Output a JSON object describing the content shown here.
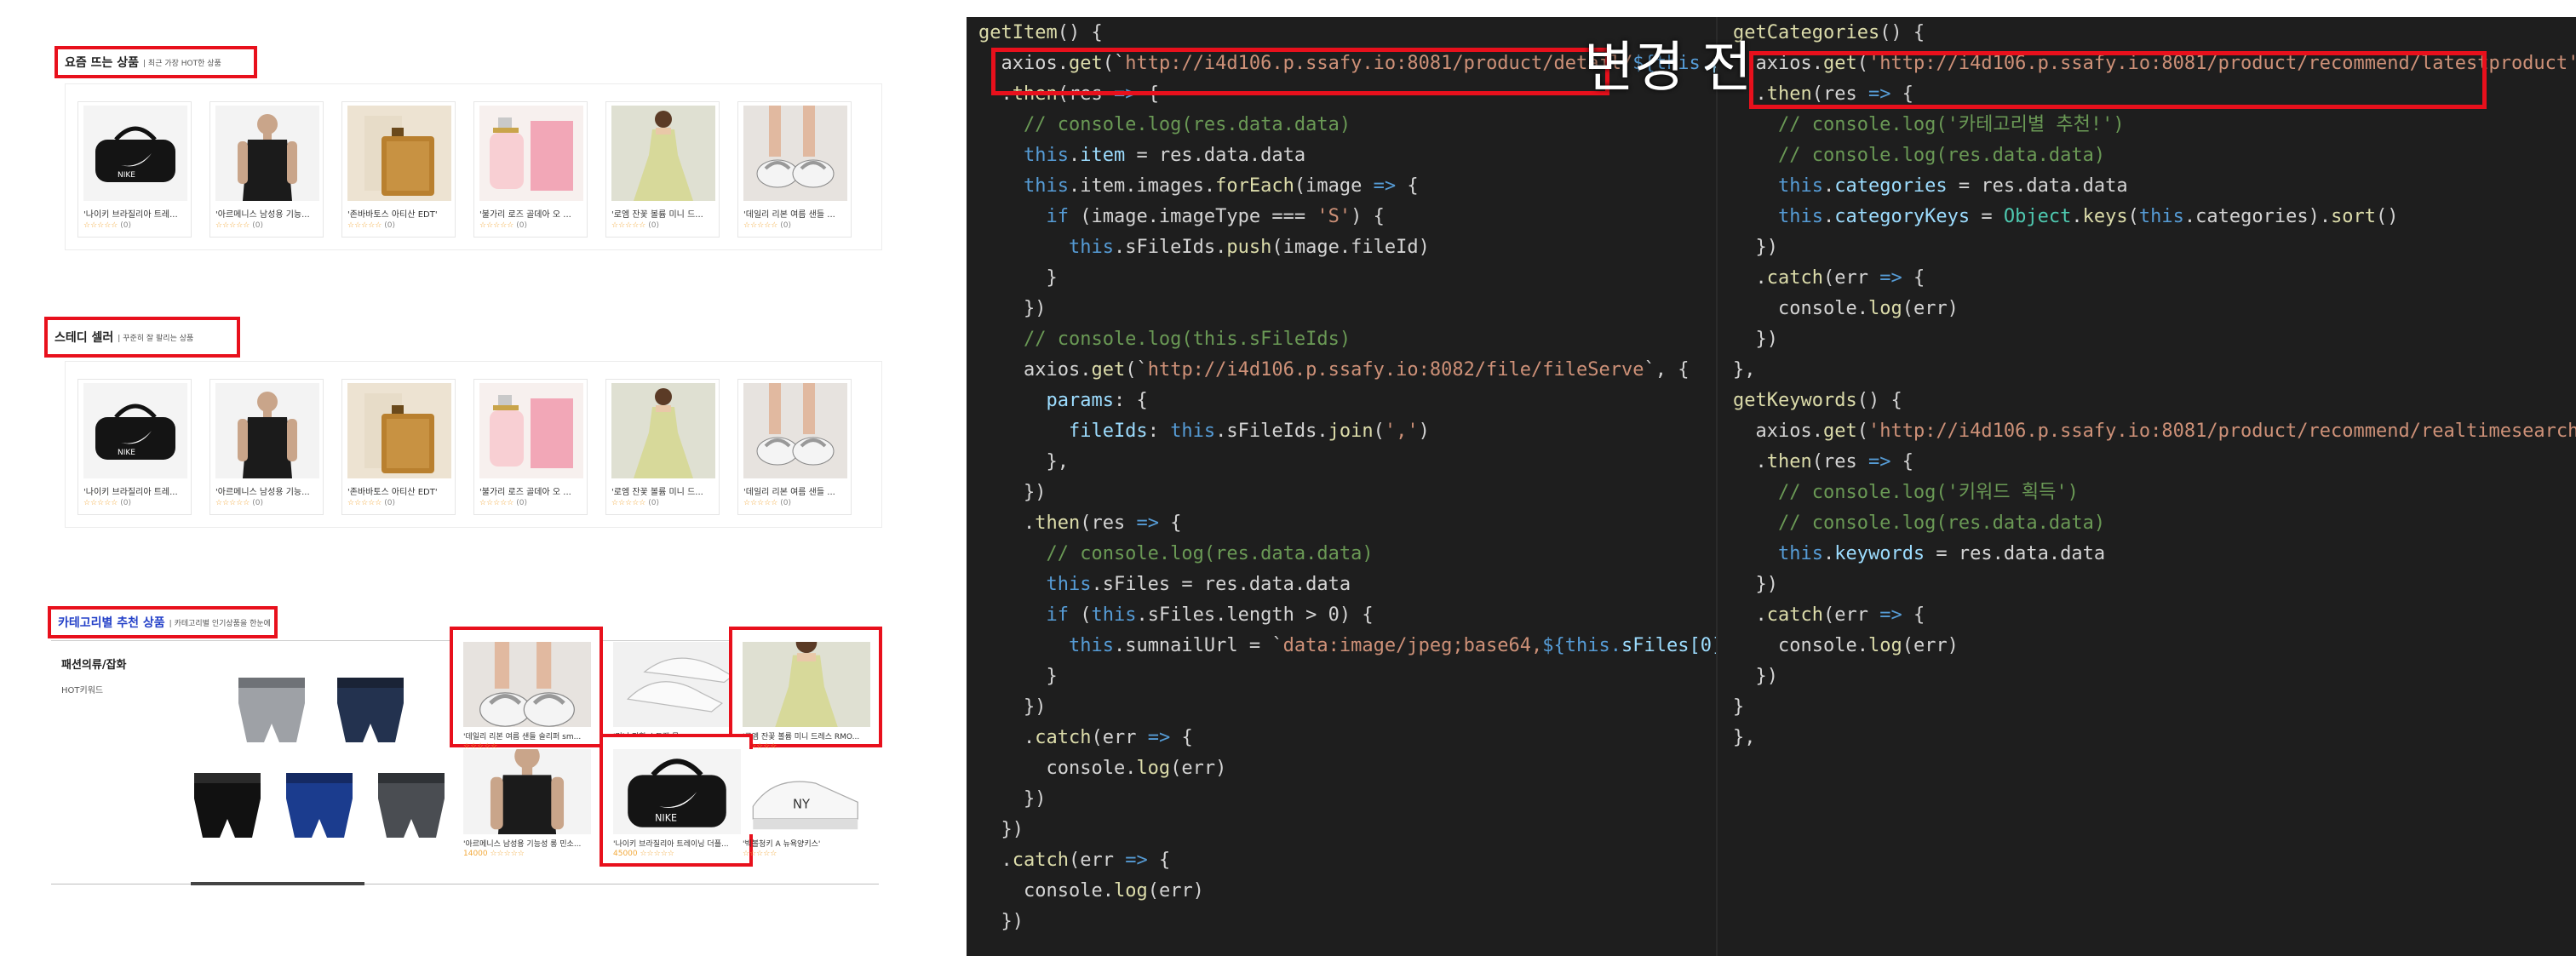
{
  "overlay_label": "변경 전",
  "shop": {
    "sections": [
      {
        "title": "요즘 뜨는 상품",
        "subtitle": "| 최근 가장 HOT한 상품"
      },
      {
        "title": "스테디 셀러",
        "subtitle": "| 꾸준히 잘 팔리는 상품"
      },
      {
        "title": "카테고리별 추천 상품",
        "subtitle": "| 카테고리별 인기상품을 한눈에"
      }
    ],
    "products": [
      {
        "name": "'나이키 브라질리아 트레...",
        "icon": "duffel-bag-icon",
        "stars": "☆☆☆☆☆",
        "count": "(0)"
      },
      {
        "name": "'아르메니스 남성용 기능...",
        "icon": "tank-top-icon",
        "stars": "☆☆☆☆☆",
        "count": "(0)"
      },
      {
        "name": "'존바바토스 아티산 EDT'",
        "icon": "perfume-bottle-icon",
        "stars": "☆☆☆☆☆",
        "count": "(0)"
      },
      {
        "name": "'불가리 로즈 골데아 오 ...",
        "icon": "perfume-pink-icon",
        "stars": "☆☆☆☆☆",
        "count": "(0)"
      },
      {
        "name": "'로엠 잔꽃 볼륨 미니 드...",
        "icon": "dress-icon",
        "stars": "☆☆☆☆☆",
        "count": "(0)"
      },
      {
        "name": "'데일리 리본 여름 샌들 ...",
        "icon": "sandals-icon",
        "stars": "☆☆☆☆☆",
        "count": "(0)"
      }
    ],
    "category": {
      "name": "패션의류/잡화",
      "keyword_label": "HOT키워드",
      "items": [
        {
          "name": "'데일리 리본 여름 샌들 슬리퍼 sm...",
          "price": "",
          "stars": "☆☆☆☆☆"
        },
        {
          "name": "'미니 핀힐 스트랩 뮬...",
          "price": "",
          "stars": "☆☆☆☆☆"
        },
        {
          "name": "'로엠 잔꽃 볼륨 미니 드레스 RMO...",
          "price": "",
          "stars": "☆☆☆☆☆"
        },
        {
          "name": "'아르메니스 남성용 기능성 롱 민소...",
          "price": "14000",
          "stars": "☆☆☆☆☆"
        },
        {
          "name": "'나이키 브라질리아 트레이닝 더플...",
          "price": "45000",
          "stars": "☆☆☆☆☆"
        },
        {
          "name": "'빅볼청키 A 뉴욕양키스'",
          "price": "",
          "stars": "☆☆☆☆☆"
        }
      ]
    }
  },
  "code_left": [
    [
      [
        "fn",
        "getItem"
      ],
      [
        "p",
        "() {"
      ]
    ],
    [
      [
        "p",
        "  axios."
      ],
      [
        "fn",
        "get"
      ],
      [
        "p",
        "(`"
      ],
      [
        "str",
        "http://i4d106.p.ssafy.io:8081/product/detail/"
      ],
      [
        "kw",
        "${this."
      ],
      [
        "prop",
        "productId"
      ],
      [
        "kw",
        "}"
      ],
      [
        "p",
        "`)"
      ]
    ],
    [
      [
        "p",
        "  ."
      ],
      [
        "fn",
        "then"
      ],
      [
        "p",
        "(res "
      ],
      [
        "arrow",
        "=>"
      ],
      [
        "p",
        " {"
      ]
    ],
    [
      [
        "cm",
        "    // console.log(res.data.data)"
      ]
    ],
    [
      [
        "kw",
        "    this"
      ],
      [
        "p",
        "."
      ],
      [
        "prop",
        "item"
      ],
      [
        "p",
        " = res.data.data"
      ]
    ],
    [
      [
        "kw",
        "    this"
      ],
      [
        "p",
        ".item.images."
      ],
      [
        "fn",
        "forEach"
      ],
      [
        "p",
        "(image "
      ],
      [
        "arrow",
        "=>"
      ],
      [
        "p",
        " {"
      ]
    ],
    [
      [
        "kw",
        "      if"
      ],
      [
        "p",
        " (image.imageType === "
      ],
      [
        "str",
        "'S'"
      ],
      [
        "p",
        ") {"
      ]
    ],
    [
      [
        "kw",
        "        this"
      ],
      [
        "p",
        ".sFileIds."
      ],
      [
        "fn",
        "push"
      ],
      [
        "p",
        "(image.fileId)"
      ]
    ],
    [
      [
        "p",
        "      }"
      ]
    ],
    [
      [
        "p",
        "    })"
      ]
    ],
    [
      [
        "cm",
        "    // console.log(this.sFileIds)"
      ]
    ],
    [
      [
        "p",
        "    axios."
      ],
      [
        "fn",
        "get"
      ],
      [
        "p",
        "(`"
      ],
      [
        "str",
        "http://i4d106.p.ssafy.io:8082/file/fileServe"
      ],
      [
        "p",
        "`, {"
      ]
    ],
    [
      [
        "prop",
        "      params"
      ],
      [
        "p",
        ": {"
      ]
    ],
    [
      [
        "prop",
        "        fileIds"
      ],
      [
        "p",
        ": "
      ],
      [
        "kw",
        "this"
      ],
      [
        "p",
        ".sFileIds."
      ],
      [
        "fn",
        "join"
      ],
      [
        "p",
        "("
      ],
      [
        "str",
        "','"
      ],
      [
        "p",
        ")"
      ]
    ],
    [
      [
        "p",
        "      },"
      ]
    ],
    [
      [
        "p",
        "    })"
      ]
    ],
    [
      [
        "p",
        "    ."
      ],
      [
        "fn",
        "then"
      ],
      [
        "p",
        "(res "
      ],
      [
        "arrow",
        "=>"
      ],
      [
        "p",
        " {"
      ]
    ],
    [
      [
        "cm",
        "      // console.log(res.data.data)"
      ]
    ],
    [
      [
        "kw",
        "      this"
      ],
      [
        "p",
        ".sFiles = res.data.data"
      ]
    ],
    [
      [
        "kw",
        "      if"
      ],
      [
        "p",
        " ("
      ],
      [
        "kw",
        "this"
      ],
      [
        "p",
        ".sFiles.length > 0) {"
      ]
    ],
    [
      [
        "kw",
        "        this"
      ],
      [
        "p",
        ".sumnailUrl = `"
      ],
      [
        "str",
        "data:image/jpeg;base64,"
      ],
      [
        "kw",
        "${this."
      ],
      [
        "prop",
        "sFiles[0].imageBytes"
      ],
      [
        "kw",
        "}"
      ],
      [
        "p",
        "`"
      ]
    ],
    [
      [
        "p",
        "      }"
      ]
    ],
    [
      [
        "p",
        "    })"
      ]
    ],
    [
      [
        "p",
        "    ."
      ],
      [
        "fn",
        "catch"
      ],
      [
        "p",
        "(err "
      ],
      [
        "arrow",
        "=>"
      ],
      [
        "p",
        " {"
      ]
    ],
    [
      [
        "p",
        "      console."
      ],
      [
        "fn",
        "log"
      ],
      [
        "p",
        "(err)"
      ]
    ],
    [
      [
        "p",
        "    })"
      ]
    ],
    [
      [
        "p",
        "  })"
      ]
    ],
    [
      [
        "p",
        "  ."
      ],
      [
        "fn",
        "catch"
      ],
      [
        "p",
        "(err "
      ],
      [
        "arrow",
        "=>"
      ],
      [
        "p",
        " {"
      ]
    ],
    [
      [
        "p",
        "    console."
      ],
      [
        "fn",
        "log"
      ],
      [
        "p",
        "(err)"
      ]
    ],
    [
      [
        "p",
        "  })"
      ]
    ]
  ],
  "code_right": [
    [
      [
        "fn",
        "getCategories"
      ],
      [
        "p",
        "() {"
      ]
    ],
    [
      [
        "p",
        "  axios."
      ],
      [
        "fn",
        "get"
      ],
      [
        "p",
        "("
      ],
      [
        "str",
        "'http://i4d106.p.ssafy.io:8081/product/recommend/latestproduct'"
      ],
      [
        "p",
        ")"
      ]
    ],
    [
      [
        "p",
        "  ."
      ],
      [
        "fn",
        "then"
      ],
      [
        "p",
        "(res "
      ],
      [
        "arrow",
        "=>"
      ],
      [
        "p",
        " {"
      ]
    ],
    [
      [
        "cm",
        "    // console.log('카테고리별 추천!')"
      ]
    ],
    [
      [
        "cm",
        "    // console.log(res.data.data)"
      ]
    ],
    [
      [
        "kw",
        "    this"
      ],
      [
        "p",
        "."
      ],
      [
        "prop",
        "categories"
      ],
      [
        "p",
        " = res.data.data"
      ]
    ],
    [
      [
        "kw",
        "    this"
      ],
      [
        "p",
        "."
      ],
      [
        "prop",
        "categoryKeys"
      ],
      [
        "p",
        " = "
      ],
      [
        "cls",
        "Object"
      ],
      [
        "p",
        "."
      ],
      [
        "fn",
        "keys"
      ],
      [
        "p",
        "("
      ],
      [
        "kw",
        "this"
      ],
      [
        "p",
        ".categories)."
      ],
      [
        "fn",
        "sort"
      ],
      [
        "p",
        "()"
      ]
    ],
    [
      [
        "p",
        "  })"
      ]
    ],
    [
      [
        "p",
        "  ."
      ],
      [
        "fn",
        "catch"
      ],
      [
        "p",
        "(err "
      ],
      [
        "arrow",
        "=>"
      ],
      [
        "p",
        " {"
      ]
    ],
    [
      [
        "p",
        "    console."
      ],
      [
        "fn",
        "log"
      ],
      [
        "p",
        "(err)"
      ]
    ],
    [
      [
        "p",
        "  })"
      ]
    ],
    [
      [
        "p",
        "},"
      ]
    ],
    [
      [
        "fn",
        "getKeywords"
      ],
      [
        "p",
        "() {"
      ]
    ],
    [
      [
        "p",
        "  axios."
      ],
      [
        "fn",
        "get"
      ],
      [
        "p",
        "("
      ],
      [
        "str",
        "'http://i4d106.p.ssafy.io:8081/product/recommend/realtimesearchword'"
      ],
      [
        "p",
        ")"
      ]
    ],
    [
      [
        "p",
        "  ."
      ],
      [
        "fn",
        "then"
      ],
      [
        "p",
        "(res "
      ],
      [
        "arrow",
        "=>"
      ],
      [
        "p",
        " {"
      ]
    ],
    [
      [
        "cm",
        "    // console.log('키워드 획득')"
      ]
    ],
    [
      [
        "cm",
        "    // console.log(res.data.data)"
      ]
    ],
    [
      [
        "kw",
        "    this"
      ],
      [
        "p",
        "."
      ],
      [
        "prop",
        "keywords"
      ],
      [
        "p",
        " = res.data.data"
      ]
    ],
    [
      [
        "p",
        "  })"
      ]
    ],
    [
      [
        "p",
        "  ."
      ],
      [
        "fn",
        "catch"
      ],
      [
        "p",
        "(err "
      ],
      [
        "arrow",
        "=>"
      ],
      [
        "p",
        " {"
      ]
    ],
    [
      [
        "p",
        "    console."
      ],
      [
        "fn",
        "log"
      ],
      [
        "p",
        "(err)"
      ]
    ],
    [
      [
        "p",
        "  })"
      ]
    ],
    [
      [
        "p",
        "}"
      ]
    ],
    [
      [
        "p",
        "},"
      ]
    ]
  ]
}
